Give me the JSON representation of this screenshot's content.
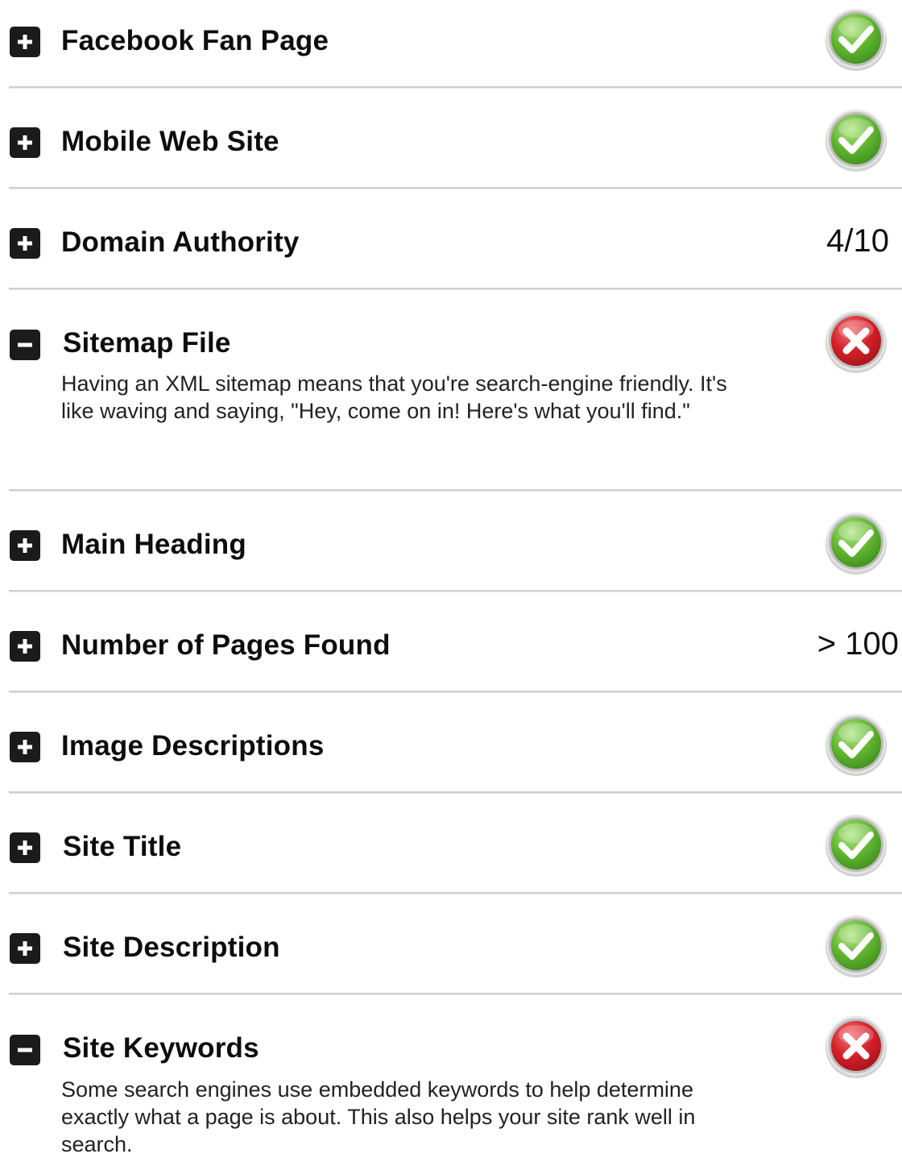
{
  "colors": {
    "success": "#62b531",
    "error": "#d42028",
    "toggle": "#1b1b1b",
    "divider": "#cfcfcf"
  },
  "rows": [
    {
      "label": "Facebook Fan Page",
      "expanded": false,
      "status": "pass",
      "icon": "check-circle-icon"
    },
    {
      "label": "Mobile Web Site",
      "expanded": false,
      "status": "pass",
      "icon": "check-circle-icon"
    },
    {
      "label": "Domain Authority",
      "expanded": false,
      "status": "value",
      "value": "4/10"
    },
    {
      "label": "Sitemap File",
      "expanded": true,
      "status": "fail",
      "icon": "x-circle-icon",
      "description": "Having an XML sitemap means that you're search-engine friendly. It's like waving and saying, \"Hey, come on in! Here's what you'll find.\""
    },
    {
      "label": "Main Heading",
      "expanded": false,
      "status": "pass",
      "icon": "check-circle-icon"
    },
    {
      "label": "Number of Pages Found",
      "expanded": false,
      "status": "value",
      "value": "> 100"
    },
    {
      "label": "Image Descriptions",
      "expanded": false,
      "status": "pass",
      "icon": "check-circle-icon"
    },
    {
      "label": "Site Title",
      "expanded": false,
      "status": "pass",
      "icon": "check-circle-icon"
    },
    {
      "label": "Site Description",
      "expanded": false,
      "status": "pass",
      "icon": "check-circle-icon"
    },
    {
      "label": "Site Keywords",
      "expanded": true,
      "status": "fail",
      "icon": "x-circle-icon",
      "description": "Some search engines use embedded keywords to help determine exactly what a page is about. This also helps your site rank well in search."
    }
  ]
}
